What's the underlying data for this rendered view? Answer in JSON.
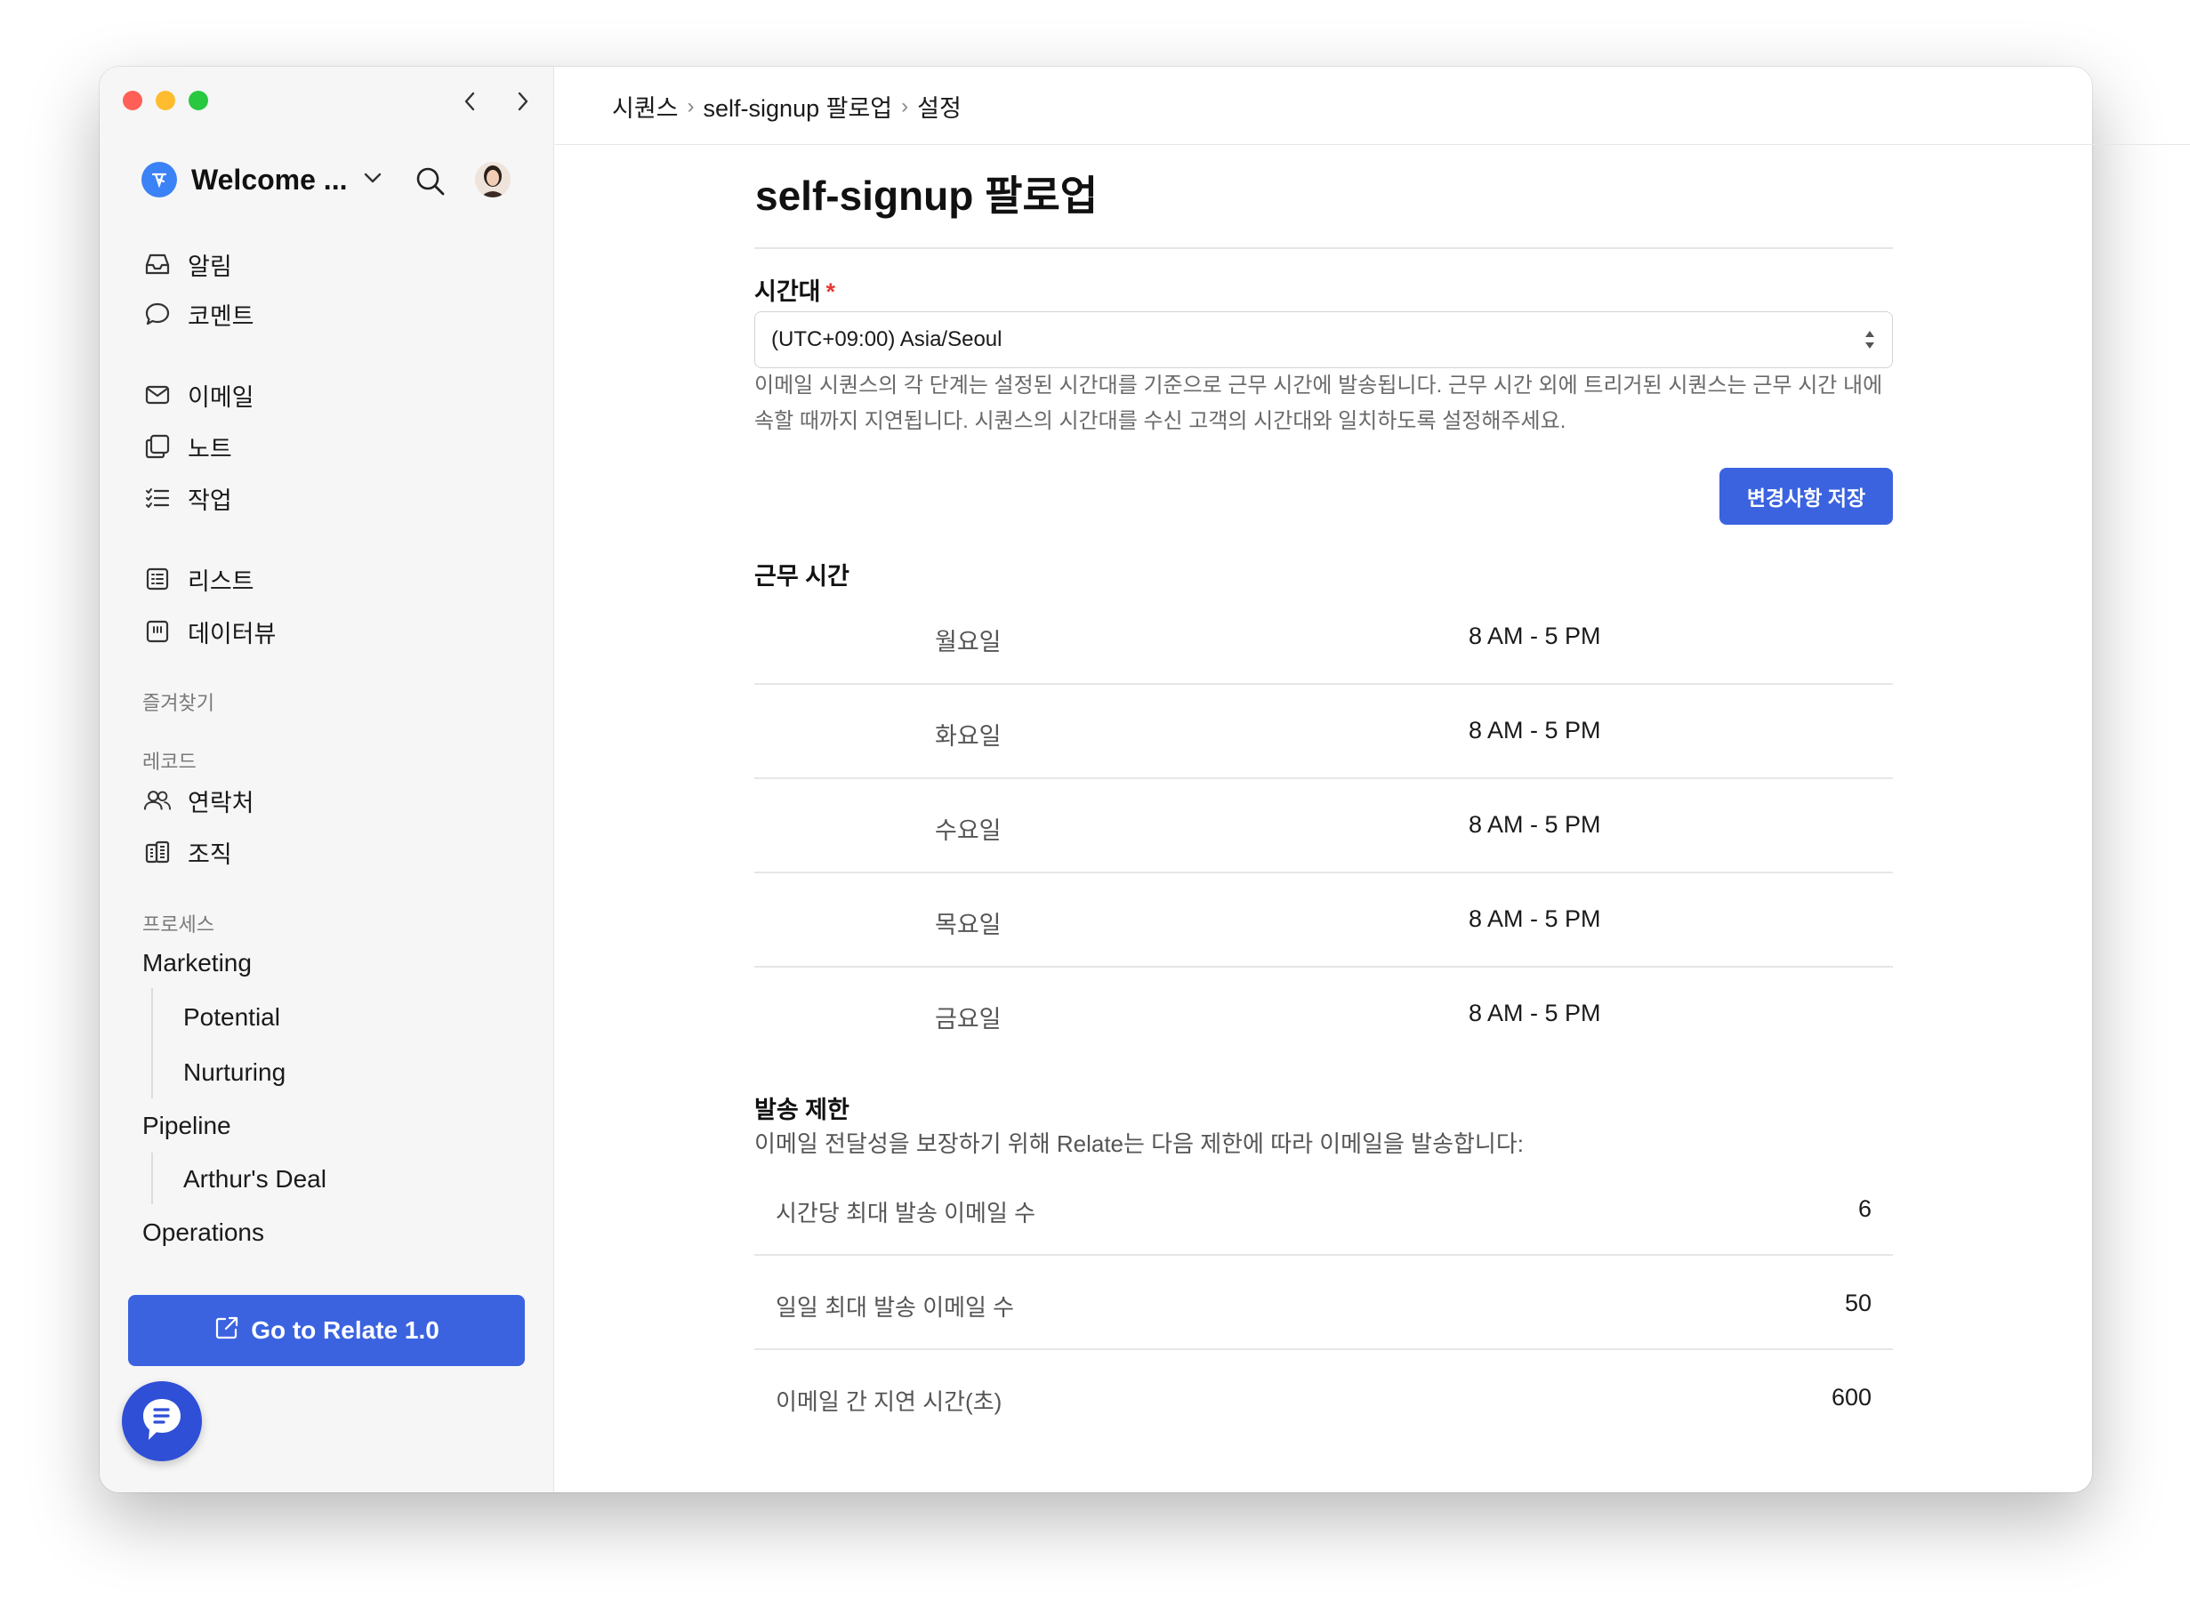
{
  "colors": {
    "accent": "#3b63e0",
    "required": "#e53935",
    "sidebar_bg": "#f6f6f6",
    "traffic_red": "#ff5f57",
    "traffic_yellow": "#febc2e",
    "traffic_green": "#28c840"
  },
  "sidebar": {
    "workspace_name": "Welcome ...",
    "nav_group_1": [
      {
        "label": "알림",
        "icon": "inbox-icon"
      },
      {
        "label": "코멘트",
        "icon": "comment-icon"
      }
    ],
    "nav_group_2": [
      {
        "label": "이메일",
        "icon": "mail-icon"
      },
      {
        "label": "노트",
        "icon": "note-icon"
      },
      {
        "label": "작업",
        "icon": "task-list-icon"
      }
    ],
    "nav_group_3": [
      {
        "label": "리스트",
        "icon": "list-icon"
      },
      {
        "label": "데이터뷰",
        "icon": "dataview-icon"
      }
    ],
    "favorites_label": "즐겨찾기",
    "records_label": "레코드",
    "records": [
      {
        "label": "연락처",
        "icon": "contacts-icon"
      },
      {
        "label": "조직",
        "icon": "organization-icon"
      }
    ],
    "process_label": "프로세스",
    "processes": {
      "marketing": "Marketing",
      "marketing_children": [
        "Potential",
        "Nurturing"
      ],
      "pipeline": "Pipeline",
      "pipeline_children": [
        "Arthur's Deal"
      ],
      "operations": "Operations"
    },
    "go_button": "Go to Relate 1.0"
  },
  "breadcrumb": [
    "시퀀스",
    "self-signup 팔로업",
    "설정"
  ],
  "page": {
    "title": "self-signup 팔로업",
    "timezone_label": "시간대",
    "required_mark": "*",
    "timezone_value": "(UTC+09:00) Asia/Seoul",
    "help_line_1": "이메일 시퀀스의 각 단계는 설정된 시간대를 기준으로 근무 시간에 발송됩니다. 근무 시간 외에 트리거된 시퀀스는 근무 시간 내에",
    "help_line_2": "속할 때까지 지연됩니다. 시퀀스의 시간대를 수신 고객의 시간대와 일치하도록 설정해주세요.",
    "save_button": "변경사항 저장",
    "working_hours_title": "근무 시간",
    "working_hours": [
      {
        "day": "월요일",
        "hours": "8 AM - 5 PM"
      },
      {
        "day": "화요일",
        "hours": "8 AM - 5 PM"
      },
      {
        "day": "수요일",
        "hours": "8 AM - 5 PM"
      },
      {
        "day": "목요일",
        "hours": "8 AM - 5 PM"
      },
      {
        "day": "금요일",
        "hours": "8 AM - 5 PM"
      }
    ],
    "limits_title": "발송 제한",
    "limits_desc": "이메일 전달성을 보장하기 위해 Relate는 다음 제한에 따라 이메일을 발송합니다:",
    "limits": [
      {
        "label": "시간당 최대 발송 이메일 수",
        "value": "6"
      },
      {
        "label": "일일 최대 발송 이메일 수",
        "value": "50"
      },
      {
        "label": "이메일 간 지연 시간(초)",
        "value": "600"
      }
    ]
  }
}
